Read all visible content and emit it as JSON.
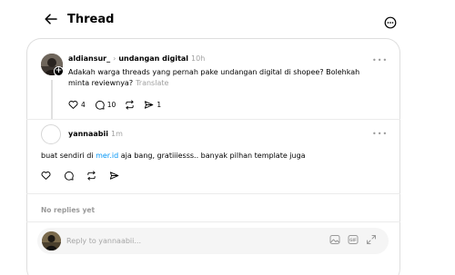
{
  "header": {
    "title": "Thread"
  },
  "post": {
    "username": "aldiansur_",
    "tag": "undangan digital",
    "time": "10h",
    "text": "Adakah warga threads yang pernah pake undangan digital di shopee? Bolehkah minta reviewnya?",
    "translate_label": "Translate",
    "like_count": "4",
    "comment_count": "10",
    "share_count": "1"
  },
  "reply": {
    "username": "yannaabii",
    "time": "1m",
    "text_before_link": "buat sendiri di ",
    "link_text": "mer.id",
    "text_after_link": " aja bang, gratiiiesss.. banyak pilhan template juga"
  },
  "no_replies_label": "No replies yet",
  "composer": {
    "placeholder": "Reply to yannaabii..."
  },
  "icons": {
    "back": "arrow-left-icon",
    "more": "more-circle-icon",
    "like": "heart-icon",
    "comment": "comment-icon",
    "repost": "repost-icon",
    "share": "send-icon",
    "image": "image-icon",
    "gif": "gif-icon",
    "expand": "expand-icon"
  }
}
